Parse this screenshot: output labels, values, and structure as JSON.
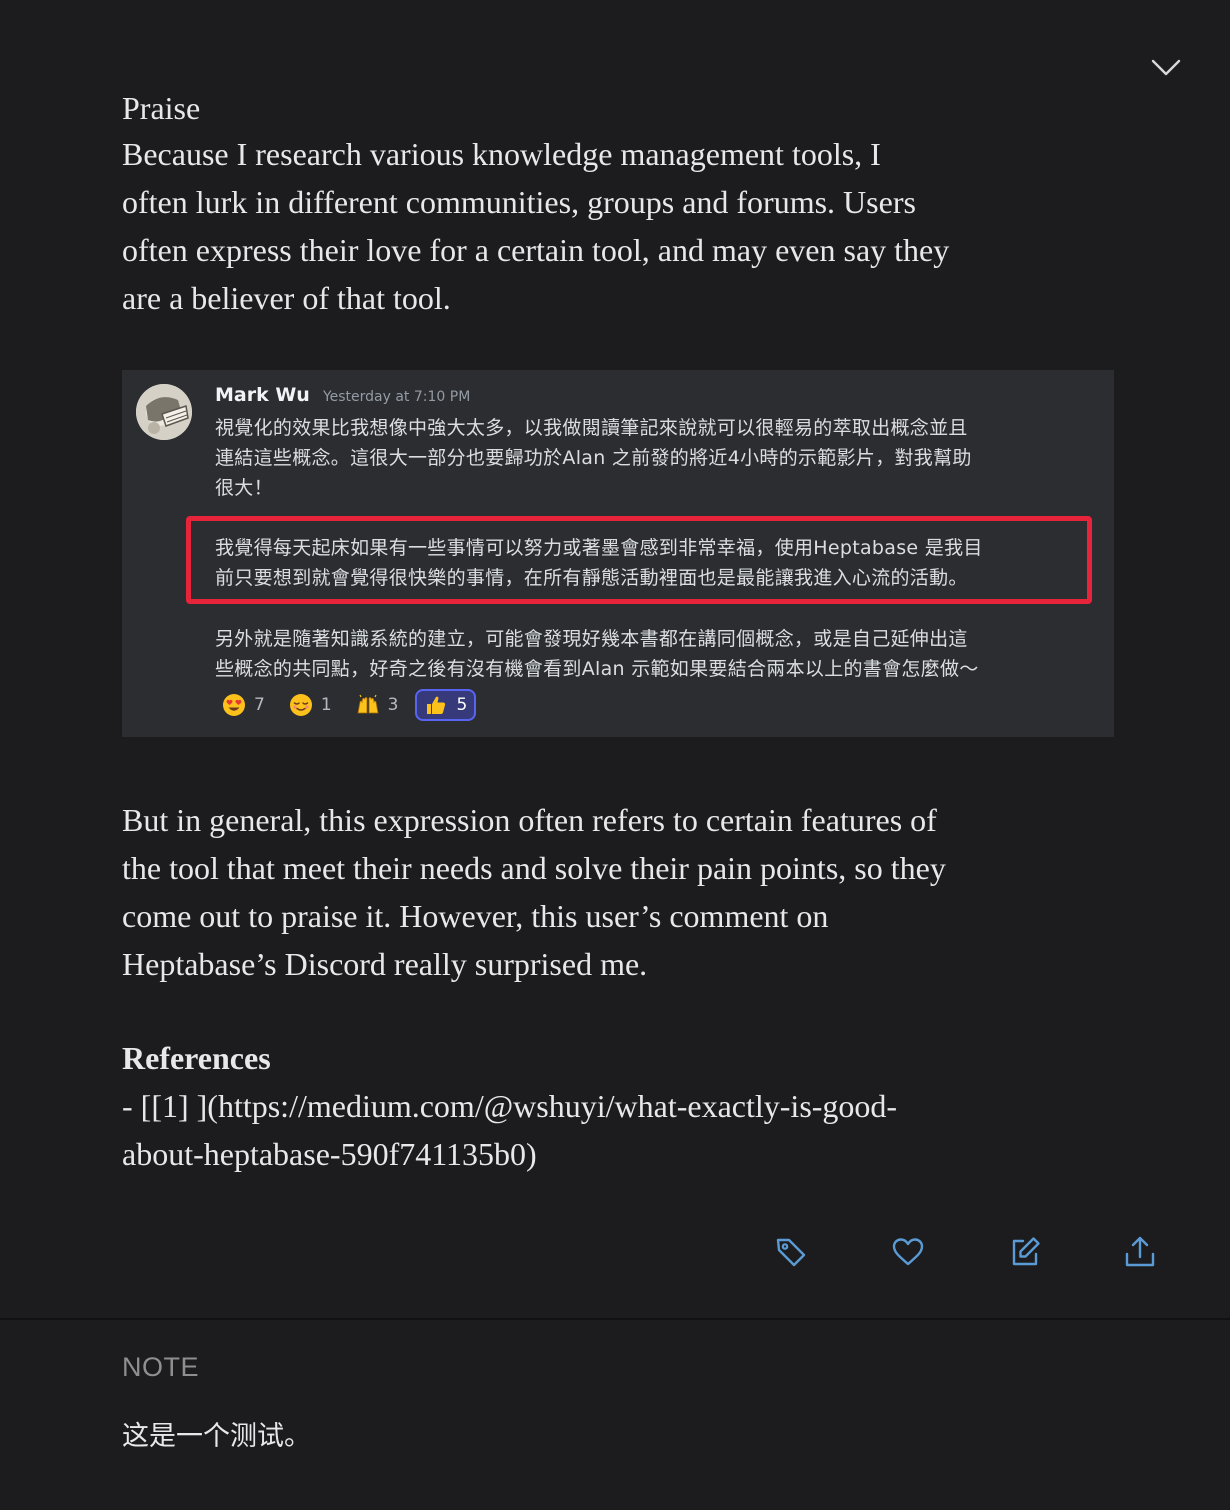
{
  "card": {
    "title": "Praise",
    "paragraph1": [
      "Because I research various knowledge management tools, I",
      "often lurk in different communities, groups and forums. Users",
      "often express their love for a certain tool, and may even say they",
      "are a believer of that tool."
    ],
    "embed": {
      "username": "Mark Wu",
      "timestamp": "Yesterday at 7:10 PM",
      "message_lines": [
        "視覺化的效果比我想像中強大太多，以我做閱讀筆記來說就可以很輕易的萃取出概念並且",
        "連結這些概念。這很大一部分也要歸功於Alan 之前發的將近4小時的示範影片，對我幫助",
        "很大！"
      ],
      "highlighted_lines": [
        "我覺得每天起床如果有一些事情可以努力或著墨會感到非常幸福，使用Heptabase 是我目",
        "前只要想到就會覺得很快樂的事情，在所有靜態活動裡面也是最能讓我進入心流的活動。"
      ],
      "message_lines_2": [
        "另外就是隨著知識系統的建立，可能會發現好幾本書都在講同個概念，或是自己延伸出這",
        "些概念的共同點，好奇之後有沒有機會看到Alan 示範如果要結合兩本以上的書會怎麼做～"
      ],
      "reactions": [
        {
          "icon": "heart-eyes-emoji",
          "count": "7",
          "active": false
        },
        {
          "icon": "relieved-emoji",
          "count": "1",
          "active": false
        },
        {
          "icon": "raised-hands-emoji",
          "count": "3",
          "active": false
        },
        {
          "icon": "thumbs-up-emoji",
          "count": "5",
          "active": true
        }
      ],
      "highlight_color": "#e8243a"
    },
    "paragraph2": [
      "But in general, this expression often refers to certain features of",
      "the tool that meet their needs and solve their pain points, so they",
      "come out to praise it. However, this user’s comment on",
      "Heptabase’s Discord really surprised me."
    ],
    "references_heading": "References",
    "references_lines": [
      "- [[1] ](https://medium.com/@wshuyi/what-exactly-is-good-",
      "about-heptabase-590f741135b0)"
    ]
  },
  "actions": {
    "icons": [
      "tag-icon",
      "heart-icon",
      "edit-icon",
      "share-icon"
    ],
    "accent": "#5b9bd5"
  },
  "note": {
    "label": "NOTE",
    "text": "这是一个测试。"
  }
}
